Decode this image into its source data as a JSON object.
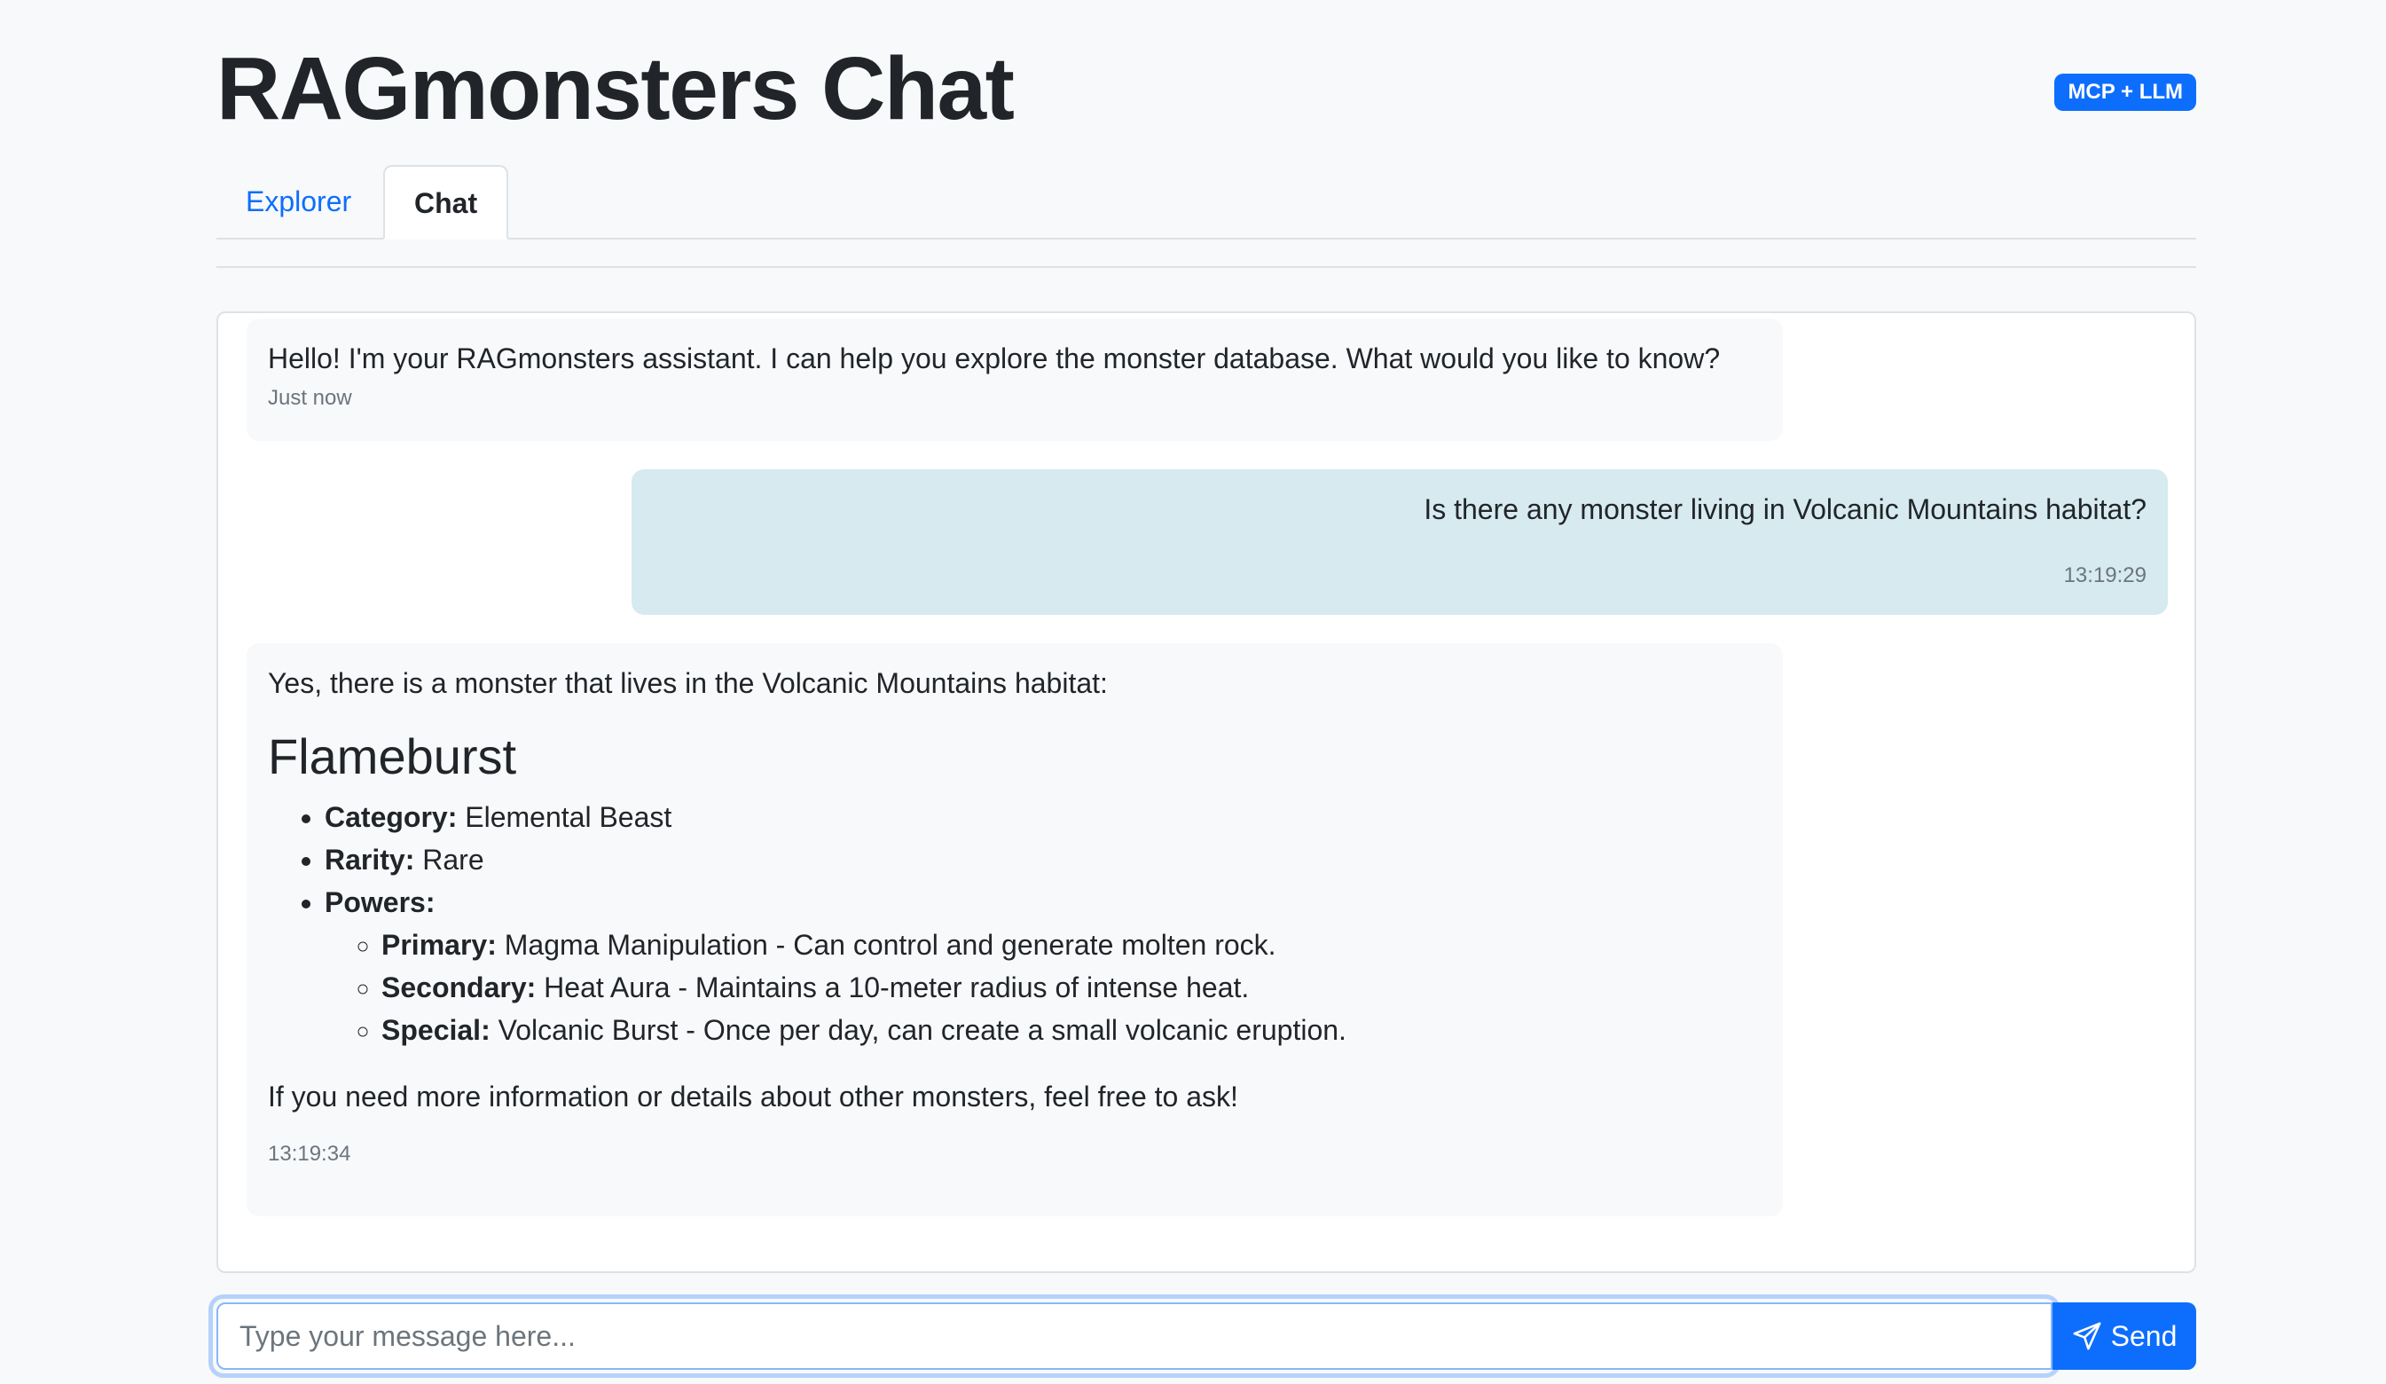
{
  "header": {
    "title": "RAGmonsters Chat",
    "badge": "MCP + LLM"
  },
  "tabs": [
    {
      "label": "Explorer",
      "active": false
    },
    {
      "label": "Chat",
      "active": true
    }
  ],
  "messages": {
    "greeting": {
      "role": "assistant",
      "text": "Hello! I'm your RAGmonsters assistant. I can help you explore the monster database. What would you like to know?",
      "time": "Just now"
    },
    "question": {
      "role": "user",
      "text": "Is there any monster living in Volcanic Mountains habitat?",
      "time": "13:19:29"
    },
    "answer": {
      "role": "assistant",
      "intro": "Yes, there is a monster that lives in the Volcanic Mountains habitat:",
      "monster_name": "Flameburst",
      "category_label": "Category:",
      "category_value": " Elemental Beast",
      "rarity_label": "Rarity:",
      "rarity_value": " Rare",
      "powers_label": "Powers:",
      "powers": {
        "primary_label": "Primary:",
        "primary_value": " Magma Manipulation - Can control and generate molten rock.",
        "secondary_label": "Secondary:",
        "secondary_value": " Heat Aura - Maintains a 10-meter radius of intense heat.",
        "special_label": "Special:",
        "special_value": " Volcanic Burst - Once per day, can create a small volcanic eruption."
      },
      "outro": "If you need more information or details about other monsters, feel free to ask!",
      "time": "13:19:34"
    }
  },
  "composer": {
    "placeholder": "Type your message here...",
    "value": "",
    "send_label": "Send",
    "send_icon": "paper-plane-icon"
  },
  "colors": {
    "accent": "#0d6efd",
    "user_bubble": "#d6eaf0",
    "assistant_bubble": "#f8f9fa",
    "page_bg": "#f8f9fa"
  }
}
